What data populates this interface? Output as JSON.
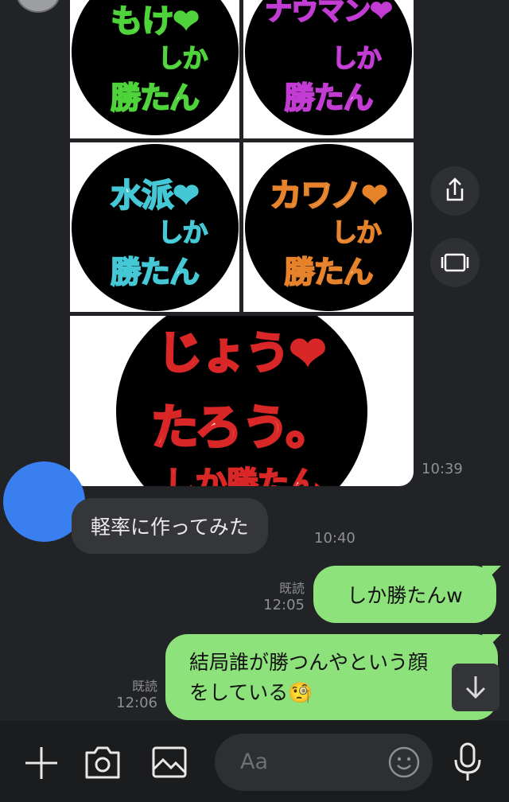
{
  "images": {
    "tiles": [
      {
        "name": "もけ",
        "sub": "しか",
        "bottom": "勝たん",
        "color": "#4fd33a",
        "heart": "❤"
      },
      {
        "name": "ナウマン",
        "sub": "しか",
        "bottom": "勝たん",
        "color": "#c23bd3",
        "heart": "❤"
      },
      {
        "name": "水派",
        "sub": "しか",
        "bottom": "勝たん",
        "color": "#45c8d6",
        "heart": "❤"
      },
      {
        "name": "カワノ",
        "sub": "しか",
        "bottom": "勝たん",
        "color": "#e6822a",
        "heart": "❤"
      }
    ],
    "big": {
      "line1": "じょう",
      "line2": "たろう。",
      "line3": "しか勝たん",
      "color": "#d92626",
      "heart": "❤"
    },
    "time": "10:39"
  },
  "messages": [
    {
      "text": "軽率に作ってみた",
      "time": "10:40"
    },
    {
      "text": "しか勝たんw",
      "read": "既読",
      "time": "12:05"
    },
    {
      "text_line1": "結局誰が勝つんやという顔",
      "text_line2": "をしている🧐",
      "read": "既読",
      "time": "12:06"
    }
  ],
  "composer": {
    "placeholder": "Aa"
  },
  "icons": [
    "plus-icon",
    "camera-icon",
    "image-icon",
    "emoji-icon",
    "mic-icon",
    "share-icon",
    "frame-icon",
    "arrow-down-icon"
  ]
}
